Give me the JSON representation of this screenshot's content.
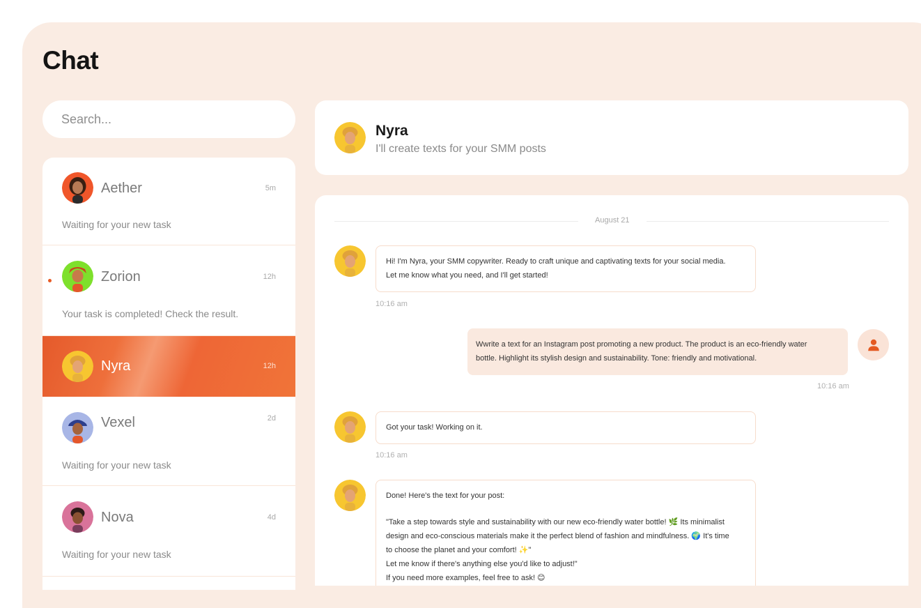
{
  "page": {
    "title": "Chat"
  },
  "search": {
    "placeholder": "Search..."
  },
  "chats": [
    {
      "name": "Aether",
      "time": "5m",
      "preview": "Waiting for your new task"
    },
    {
      "name": "Zorion",
      "time": "12h",
      "preview": "Your task is completed! Check the result.",
      "unread": true
    },
    {
      "name": "Nyra",
      "time": "12h",
      "active": true
    },
    {
      "name": "Vexel",
      "time": "2d",
      "preview": "Waiting for your new task"
    },
    {
      "name": "Nova",
      "time": "4d",
      "preview": "Waiting for your new task"
    }
  ],
  "header": {
    "name": "Nyra",
    "subtitle": "I'll create texts for your SMM posts"
  },
  "conversation": {
    "date": "August 21",
    "messages": [
      {
        "from": "bot",
        "lines": [
          "Hi! I'm Nyra, your SMM copywriter. Ready to craft unique and captivating texts for your social media.",
          "Let me know what you need, and I'll get started!"
        ],
        "time": "10:16 am"
      },
      {
        "from": "user",
        "lines": [
          "Wwrite a text for an Instagram post promoting a new product. The product is an eco-friendly water",
          "bottle. Highlight its stylish design and sustainability. Tone: friendly and motivational."
        ],
        "time": "10:16 am"
      },
      {
        "from": "bot",
        "lines": [
          "Got your task! Working on it."
        ],
        "time": "10:16 am"
      },
      {
        "from": "bot",
        "lines": [
          "Done! Here's the text for your post:",
          "",
          "\"Take a step towards style and sustainability with our new eco-friendly water bottle! 🌿 Its minimalist",
          "design and eco-conscious materials make it the perfect blend of fashion and mindfulness. 🌍 It's time",
          "to choose the planet and your comfort! ✨\"",
          "Let me know if there's anything else you'd like to adjust!\"",
          "If you need more examples, feel free to ask! 😊"
        ]
      }
    ]
  },
  "colors": {
    "accent": "#ee6636",
    "panel": "#faece3",
    "bubble_out": "#fae9df",
    "bubble_border": "#f7dccb"
  }
}
